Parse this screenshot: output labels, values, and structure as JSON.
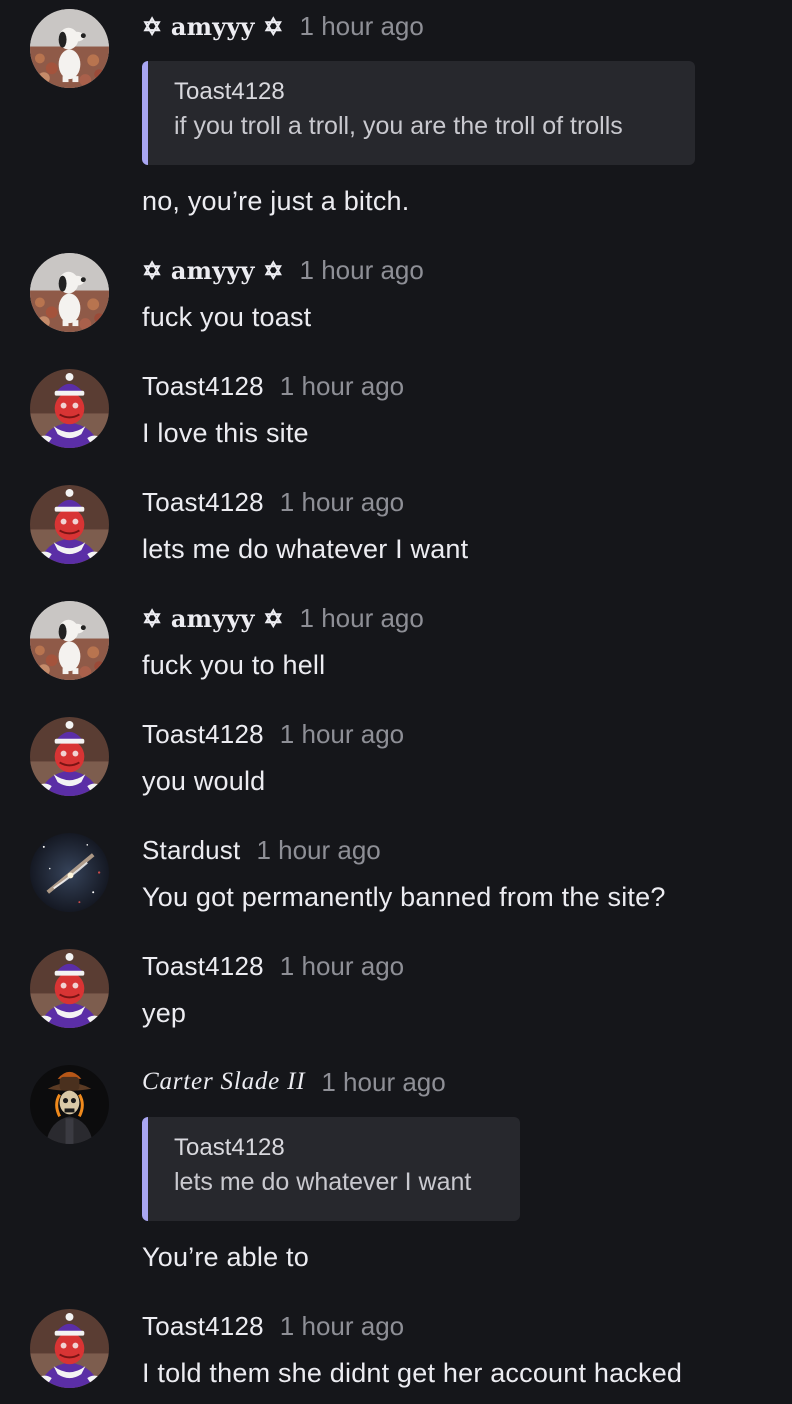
{
  "messages": [
    {
      "author": "✡ amyyy ✡",
      "time": "1 hour ago",
      "avatar": "snoopy-avatar",
      "quote": {
        "author": "Toast4128",
        "text": "if you troll a troll, you are the troll of trolls"
      },
      "text": "no, you’re just a bitch."
    },
    {
      "author": "✡ amyyy ✡",
      "time": "1 hour ago",
      "avatar": "snoopy-avatar",
      "text": "fuck you toast"
    },
    {
      "author": "Toast4128",
      "time": "1 hour ago",
      "avatar": "grinch-avatar",
      "text": "I love this site"
    },
    {
      "author": "Toast4128",
      "time": "1 hour ago",
      "avatar": "grinch-avatar",
      "text": "lets me do whatever I want"
    },
    {
      "author": "✡ amyyy ✡",
      "time": "1 hour ago",
      "avatar": "snoopy-avatar",
      "text": "fuck you to hell"
    },
    {
      "author": "Toast4128",
      "time": "1 hour ago",
      "avatar": "grinch-avatar",
      "text": "you would"
    },
    {
      "author": "Stardust",
      "time": "1 hour ago",
      "avatar": "galaxy-avatar",
      "text": "You got permanently banned from the site?"
    },
    {
      "author": "Toast4128",
      "time": "1 hour ago",
      "avatar": "grinch-avatar",
      "text": "yep"
    },
    {
      "author": "Carter Slade II",
      "time": "1 hour ago",
      "avatar": "ghost-rider-avatar",
      "quote": {
        "author": "Toast4128",
        "text": "lets me do whatever I want"
      },
      "text": "You’re able to"
    },
    {
      "author": "Toast4128",
      "time": "1 hour ago",
      "avatar": "grinch-avatar",
      "text": "I told them she didnt get her account hacked"
    }
  ],
  "colors": {
    "background": "#15161a",
    "text": "#ececf1",
    "timestamp": "#8e8f96",
    "quote_background": "#27282d",
    "quote_accent": "#a9a6f2"
  }
}
